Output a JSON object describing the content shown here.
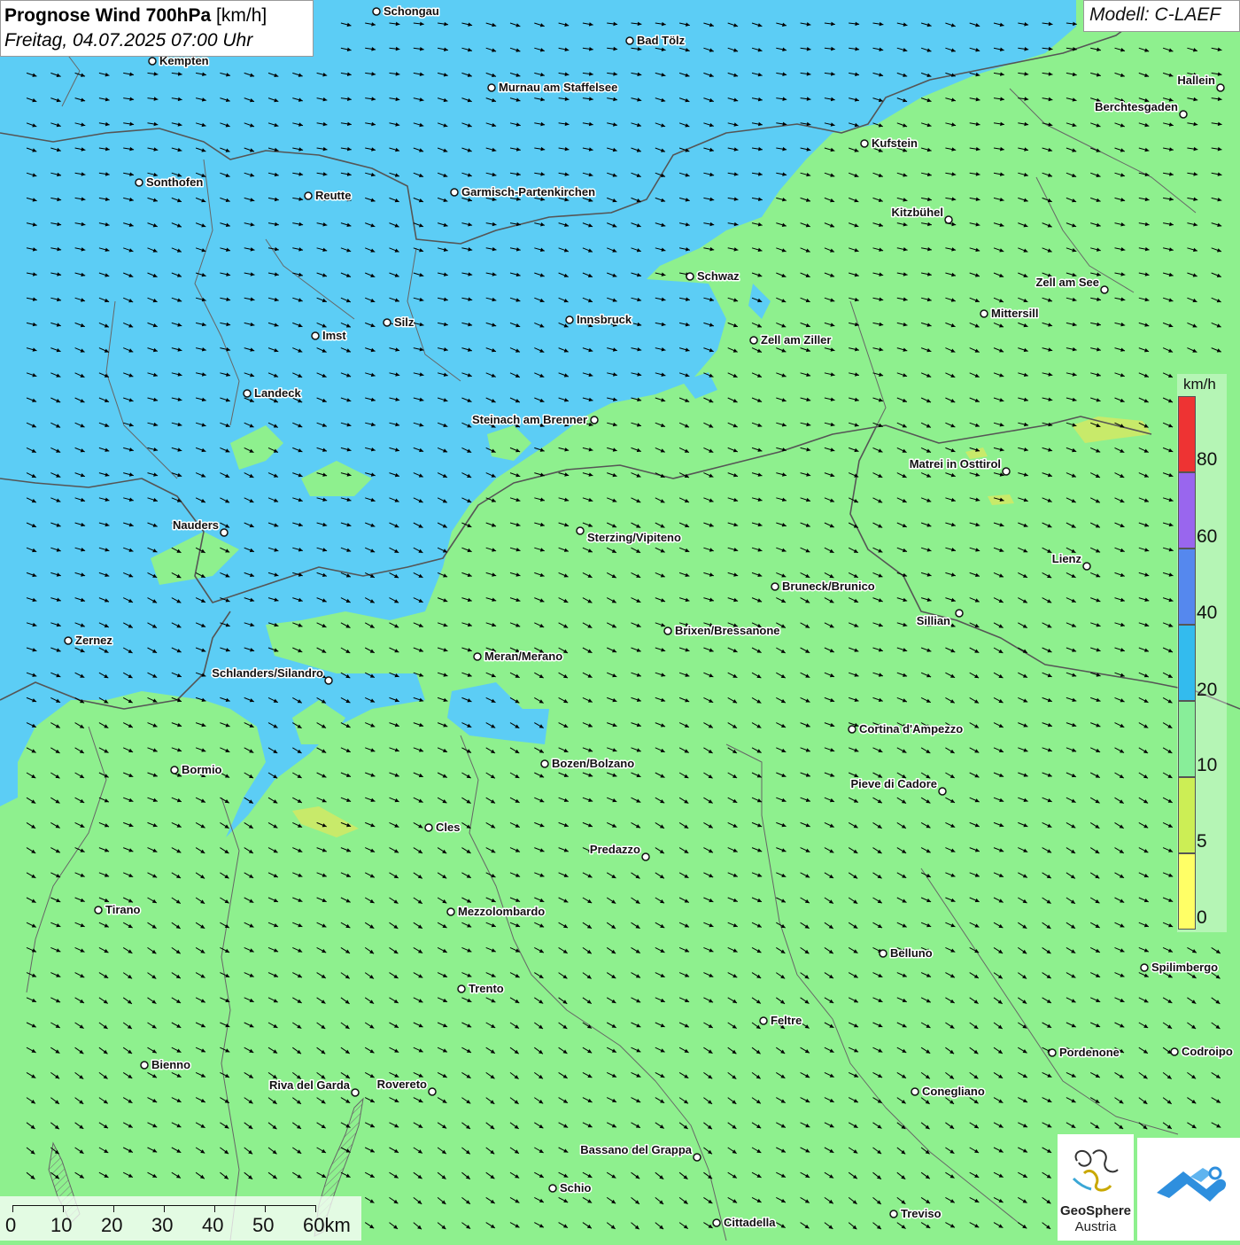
{
  "title": {
    "main": "Prognose Wind 700hPa",
    "unit": "[km/h]",
    "datetime": "Freitag, 04.07.2025 07:00 Uhr"
  },
  "model": "Modell: C-LAEF",
  "legend": {
    "unit": "km/h",
    "ticks": [
      "80",
      "60",
      "40",
      "20",
      "10",
      "5",
      "0"
    ],
    "bands": [
      {
        "from": 80,
        "color": "#ee3333"
      },
      {
        "from": 60,
        "color": "#9966ee"
      },
      {
        "from": 40,
        "color": "#5588ee"
      },
      {
        "from": 20,
        "color": "#33bbee"
      },
      {
        "from": 10,
        "color": "#88ee99"
      },
      {
        "from": 5,
        "color": "#ccee55"
      },
      {
        "from": 0,
        "color": "#ffff66"
      }
    ]
  },
  "colors": {
    "wind_20_40": "#5ccdf5",
    "wind_10_20": "#8ef08e",
    "wind_5_10": "#c8ea6a",
    "borders": "#555555",
    "arrows": "#000000"
  },
  "wind_arrows": {
    "direction": "from west-northwest towards east-southeast",
    "color": "#000000"
  },
  "cities": [
    {
      "name": "Schongau"
    },
    {
      "name": "Bad Tölz"
    },
    {
      "name": "Kempten"
    },
    {
      "name": "Murnau am Staffelsee"
    },
    {
      "name": "Hallein"
    },
    {
      "name": "Berchtesgaden"
    },
    {
      "name": "Kufstein"
    },
    {
      "name": "Sonthofen"
    },
    {
      "name": "Reutte"
    },
    {
      "name": "Garmisch-Partenkirchen"
    },
    {
      "name": "Kitzbühel"
    },
    {
      "name": "Schwaz"
    },
    {
      "name": "Zell am See"
    },
    {
      "name": "Mittersill"
    },
    {
      "name": "Innsbruck"
    },
    {
      "name": "Silz"
    },
    {
      "name": "Imst"
    },
    {
      "name": "Zell am Ziller"
    },
    {
      "name": "Landeck"
    },
    {
      "name": "Steinach am Brenner"
    },
    {
      "name": "Matrei in Osttirol"
    },
    {
      "name": "Nauders"
    },
    {
      "name": "Sterzing/Vipiteno"
    },
    {
      "name": "Lienz"
    },
    {
      "name": "Bruneck/Brunico"
    },
    {
      "name": "Sillian"
    },
    {
      "name": "Brixen/Bressanone"
    },
    {
      "name": "Zernez"
    },
    {
      "name": "Meran/Merano"
    },
    {
      "name": "Schlanders/Silandro"
    },
    {
      "name": "Cortina d'Ampezzo"
    },
    {
      "name": "Bozen/Bolzano"
    },
    {
      "name": "Bormio"
    },
    {
      "name": "Pieve di Cadore"
    },
    {
      "name": "Cles"
    },
    {
      "name": "Predazzo"
    },
    {
      "name": "Tirano"
    },
    {
      "name": "Mezzolombardo"
    },
    {
      "name": "Belluno"
    },
    {
      "name": "Spilimbergo"
    },
    {
      "name": "Trento"
    },
    {
      "name": "Feltre"
    },
    {
      "name": "Pordenone"
    },
    {
      "name": "Codroipo"
    },
    {
      "name": "Bienno"
    },
    {
      "name": "Riva del Garda"
    },
    {
      "name": "Rovereto"
    },
    {
      "name": "Conegliano"
    },
    {
      "name": "Bassano del Grappa"
    },
    {
      "name": "Schio"
    },
    {
      "name": "Treviso"
    },
    {
      "name": "Cittadella"
    }
  ],
  "scale_bar": {
    "labels": [
      "0",
      "10",
      "20",
      "30",
      "40",
      "50",
      "60km"
    ]
  },
  "logos": {
    "geosphere_name": "GeoSphere",
    "geosphere_sub": "Austria"
  }
}
